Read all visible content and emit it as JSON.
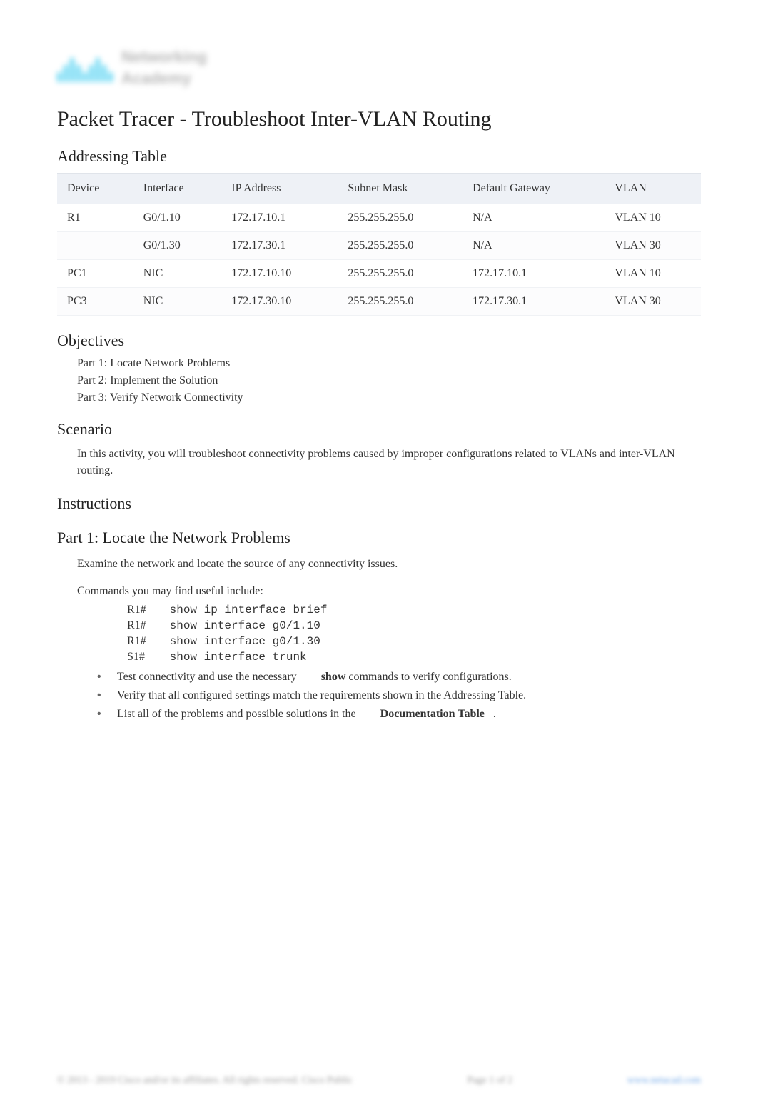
{
  "logo": {
    "line1": "Networking",
    "line2": "Academy",
    "brand": "cisco"
  },
  "title": "Packet Tracer - Troubleshoot Inter-VLAN Routing",
  "addressing": {
    "heading": "Addressing Table",
    "columns": [
      "Device",
      "Interface",
      "IP Address",
      "Subnet Mask",
      "Default Gateway",
      "VLAN"
    ],
    "rows": [
      {
        "device": "R1",
        "interface": "G0/1.10",
        "ip": "172.17.10.1",
        "mask": "255.255.255.0",
        "gw": "N/A",
        "vlan": "VLAN 10"
      },
      {
        "device": "",
        "interface": "G0/1.30",
        "ip": "172.17.30.1",
        "mask": "255.255.255.0",
        "gw": "N/A",
        "vlan": "VLAN 30"
      },
      {
        "device": "PC1",
        "interface": "NIC",
        "ip": "172.17.10.10",
        "mask": "255.255.255.0",
        "gw": "172.17.10.1",
        "vlan": "VLAN 10"
      },
      {
        "device": "PC3",
        "interface": "NIC",
        "ip": "172.17.30.10",
        "mask": "255.255.255.0",
        "gw": "172.17.30.1",
        "vlan": "VLAN 30"
      }
    ]
  },
  "objectives": {
    "heading": "Objectives",
    "items": [
      "Part 1: Locate Network Problems",
      "Part 2: Implement the Solution",
      "Part 3: Verify Network Connectivity"
    ]
  },
  "scenario": {
    "heading": "Scenario",
    "text": "In this activity, you will troubleshoot connectivity problems caused by improper configurations related to VLANs and inter-VLAN routing."
  },
  "instructions": {
    "heading": "Instructions"
  },
  "part1": {
    "heading": "Part 1: Locate the Network Problems",
    "intro": "Examine the network and locate the source of any connectivity issues.",
    "cmds_intro": "Commands you may find useful include:",
    "commands": [
      {
        "prompt": "R1#",
        "cmd": "show ip interface brief"
      },
      {
        "prompt": "R1#",
        "cmd": "show interface g0/1.10"
      },
      {
        "prompt": "R1#",
        "cmd": "show interface g0/1.30"
      },
      {
        "prompt": "S1#",
        "cmd": "show interface trunk"
      }
    ],
    "bullets": [
      {
        "pre": "Test connectivity and use the necessary ",
        "kw": "show",
        "post": " commands to verify configurations."
      },
      {
        "pre": "Verify that all configured settings match the requirements shown in the Addressing Table.",
        "kw": "",
        "post": ""
      },
      {
        "pre": "List all of the problems and possible solutions in the ",
        "kw": "Documentation Table",
        "post": "."
      }
    ]
  },
  "footer": {
    "left": "© 2013 - 2019 Cisco and/or its affiliates. All rights reserved. Cisco Public",
    "center": "Page 1 of 2",
    "right": "www.netacad.com"
  }
}
